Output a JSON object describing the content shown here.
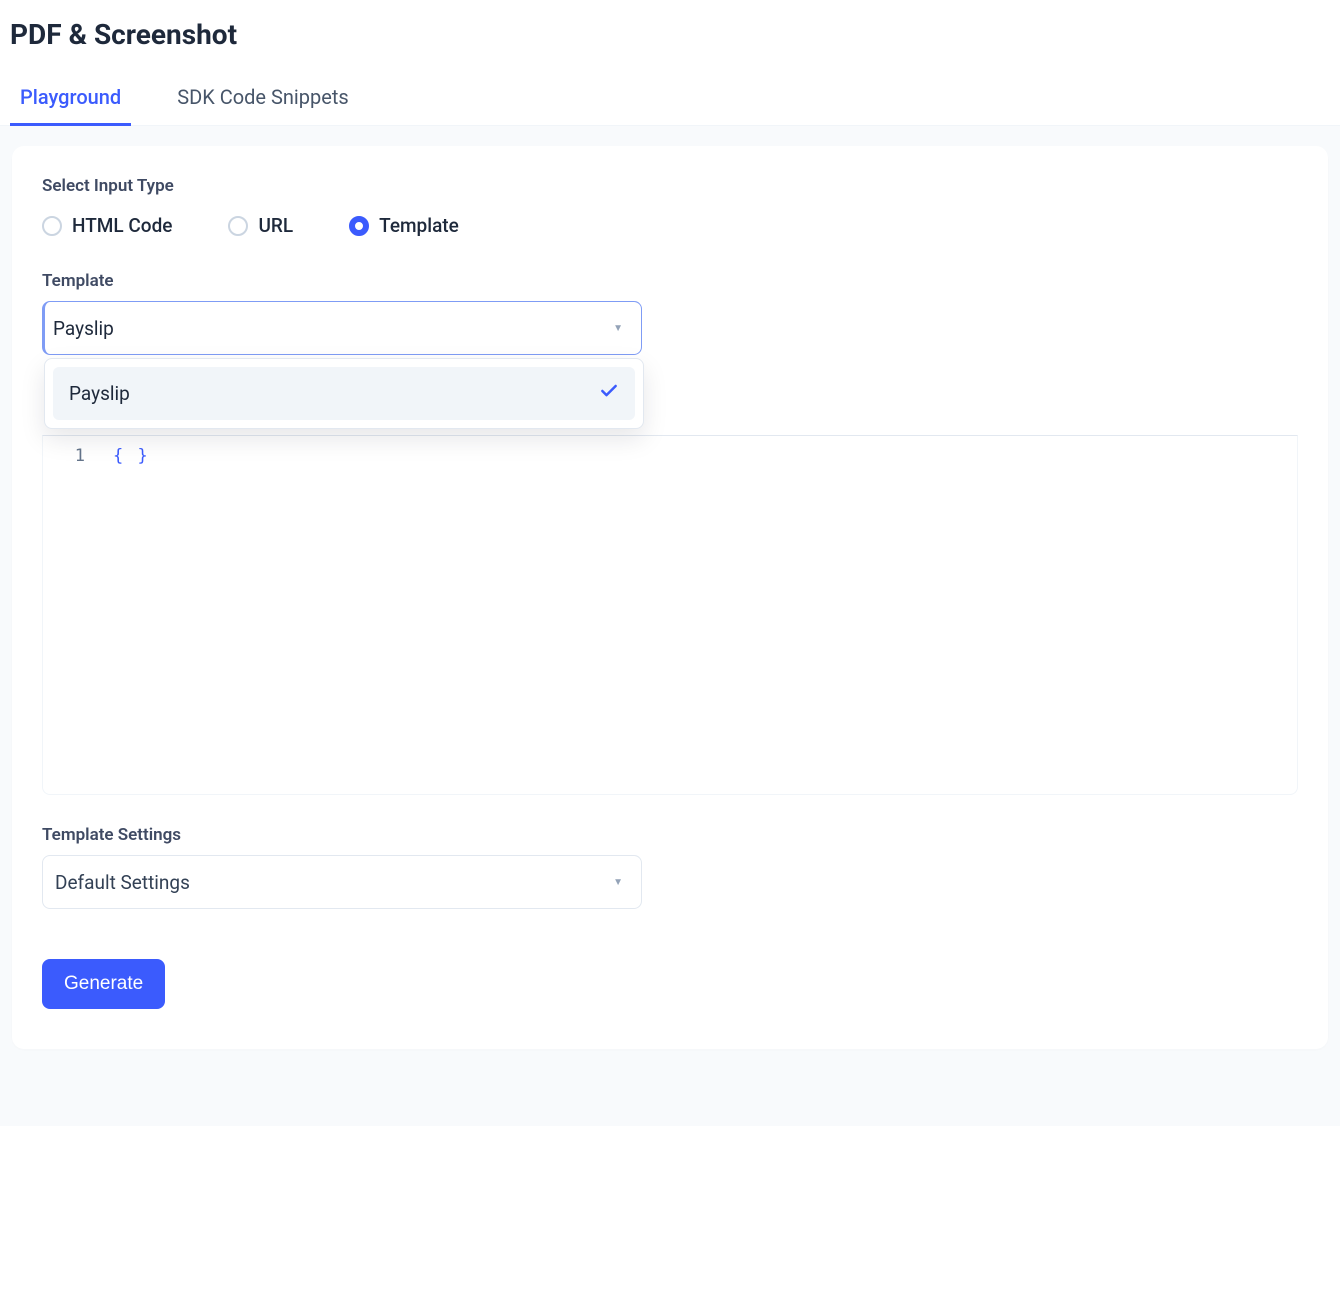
{
  "header": {
    "title": "PDF & Screenshot"
  },
  "tabs": {
    "playground": "Playground",
    "sdk": "SDK Code Snippets"
  },
  "form": {
    "input_type_label": "Select Input Type",
    "radios": {
      "html": "HTML Code",
      "url": "URL",
      "template": "Template"
    },
    "template_label": "Template",
    "template_value": "Payslip",
    "template_options": [
      "Payslip"
    ],
    "editor": {
      "line_number": "1",
      "content": "{ }"
    },
    "settings_label": "Template Settings",
    "settings_value": "Default Settings",
    "generate_label": "Generate"
  }
}
